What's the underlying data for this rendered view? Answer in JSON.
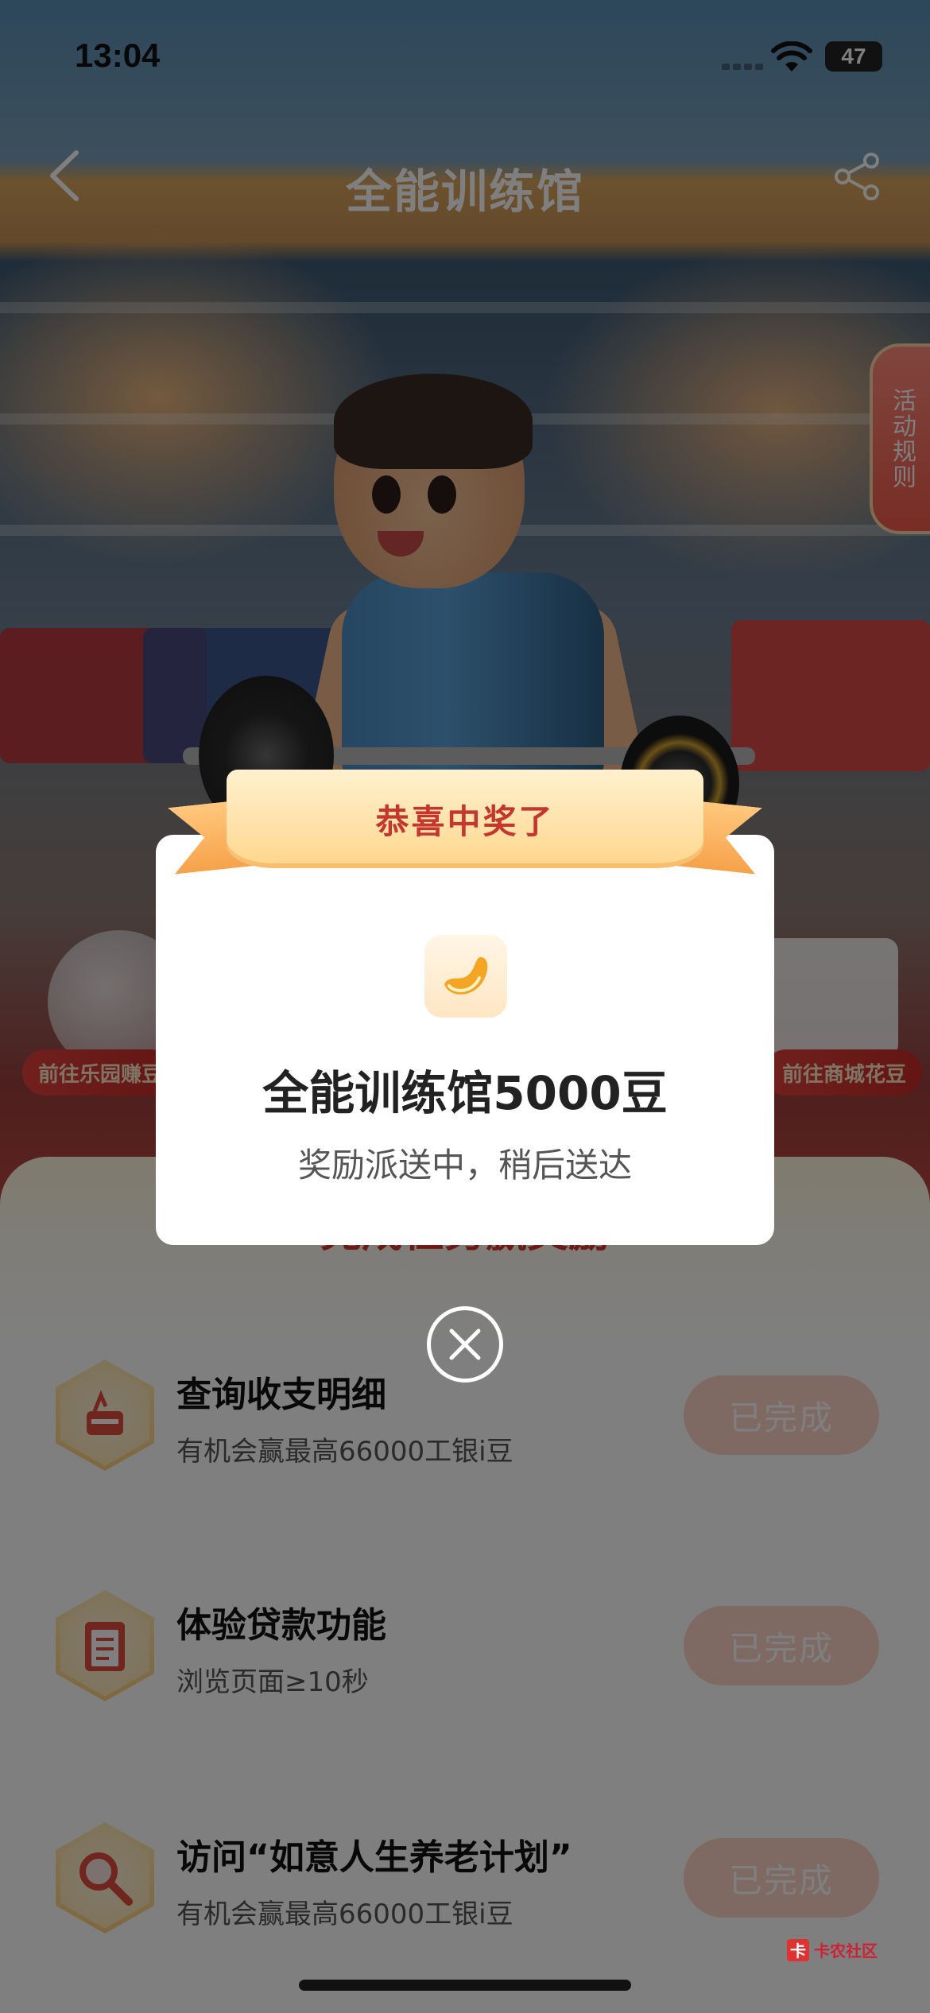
{
  "status_bar": {
    "time": "13:04",
    "battery": "47"
  },
  "nav": {
    "title": "全能训练馆"
  },
  "side_tab": {
    "label": "活动规则"
  },
  "side_left_label": "前往乐园赚豆",
  "side_right_label": "前往商城花豆",
  "panel": {
    "heading": "完成任务赢奖励",
    "tasks": [
      {
        "title": "查询收支明细",
        "desc": "有机会赢最高66000工银i豆",
        "button": "已完成"
      },
      {
        "title": "体验贷款功能",
        "desc": "浏览页面≥10秒",
        "button": "已完成"
      },
      {
        "title": "访问“如意人生养老计划”",
        "desc": "有机会赢最高66000工银i豆",
        "button": "已完成"
      }
    ]
  },
  "modal": {
    "ribbon": "恭喜中奖了",
    "prize_title": "全能训练馆5000豆",
    "prize_subtitle": "奖励派送中，稍后送达"
  },
  "watermark": "卡农社区",
  "colors": {
    "accent_red": "#d9342b",
    "ribbon": "#ffd68c",
    "done_button": "#ffd3c6"
  }
}
